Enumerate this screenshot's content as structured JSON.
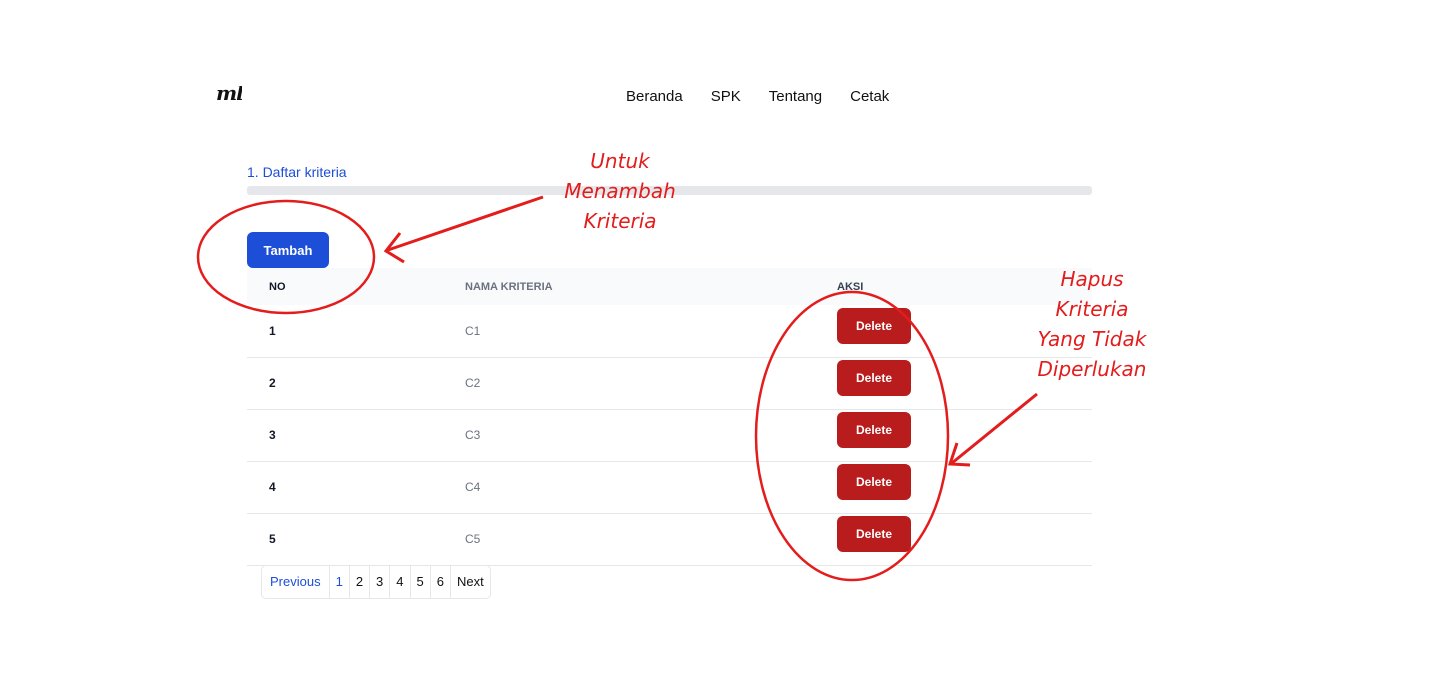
{
  "header": {
    "logo_text": "ml",
    "nav": [
      "Beranda",
      "SPK",
      "Tentang",
      "Cetak"
    ]
  },
  "section": {
    "title": "1. Daftar kriteria",
    "progress": 1.0
  },
  "add_button": "Tambah",
  "table": {
    "headers": {
      "no": "NO",
      "name": "NAMA KRITERIA",
      "action": "AKSI"
    },
    "rows": [
      {
        "no": "1",
        "name": "C1",
        "action": "Delete"
      },
      {
        "no": "2",
        "name": "C2",
        "action": "Delete"
      },
      {
        "no": "3",
        "name": "C3",
        "action": "Delete"
      },
      {
        "no": "4",
        "name": "C4",
        "action": "Delete"
      },
      {
        "no": "5",
        "name": "C5",
        "action": "Delete"
      }
    ]
  },
  "pagination": {
    "prev": "Previous",
    "pages": [
      "1",
      "2",
      "3",
      "4",
      "5",
      "6"
    ],
    "current": "1",
    "next": "Next"
  },
  "annotations": {
    "add": [
      "Untuk",
      "Menambah",
      "Kriteria"
    ],
    "delete": [
      "Hapus",
      "Kriteria",
      "Yang Tidak",
      "Diperlukan"
    ]
  },
  "colors": {
    "primary": "#1d4ed8",
    "danger": "#b91c1c",
    "annotation": "#e31c1c"
  }
}
